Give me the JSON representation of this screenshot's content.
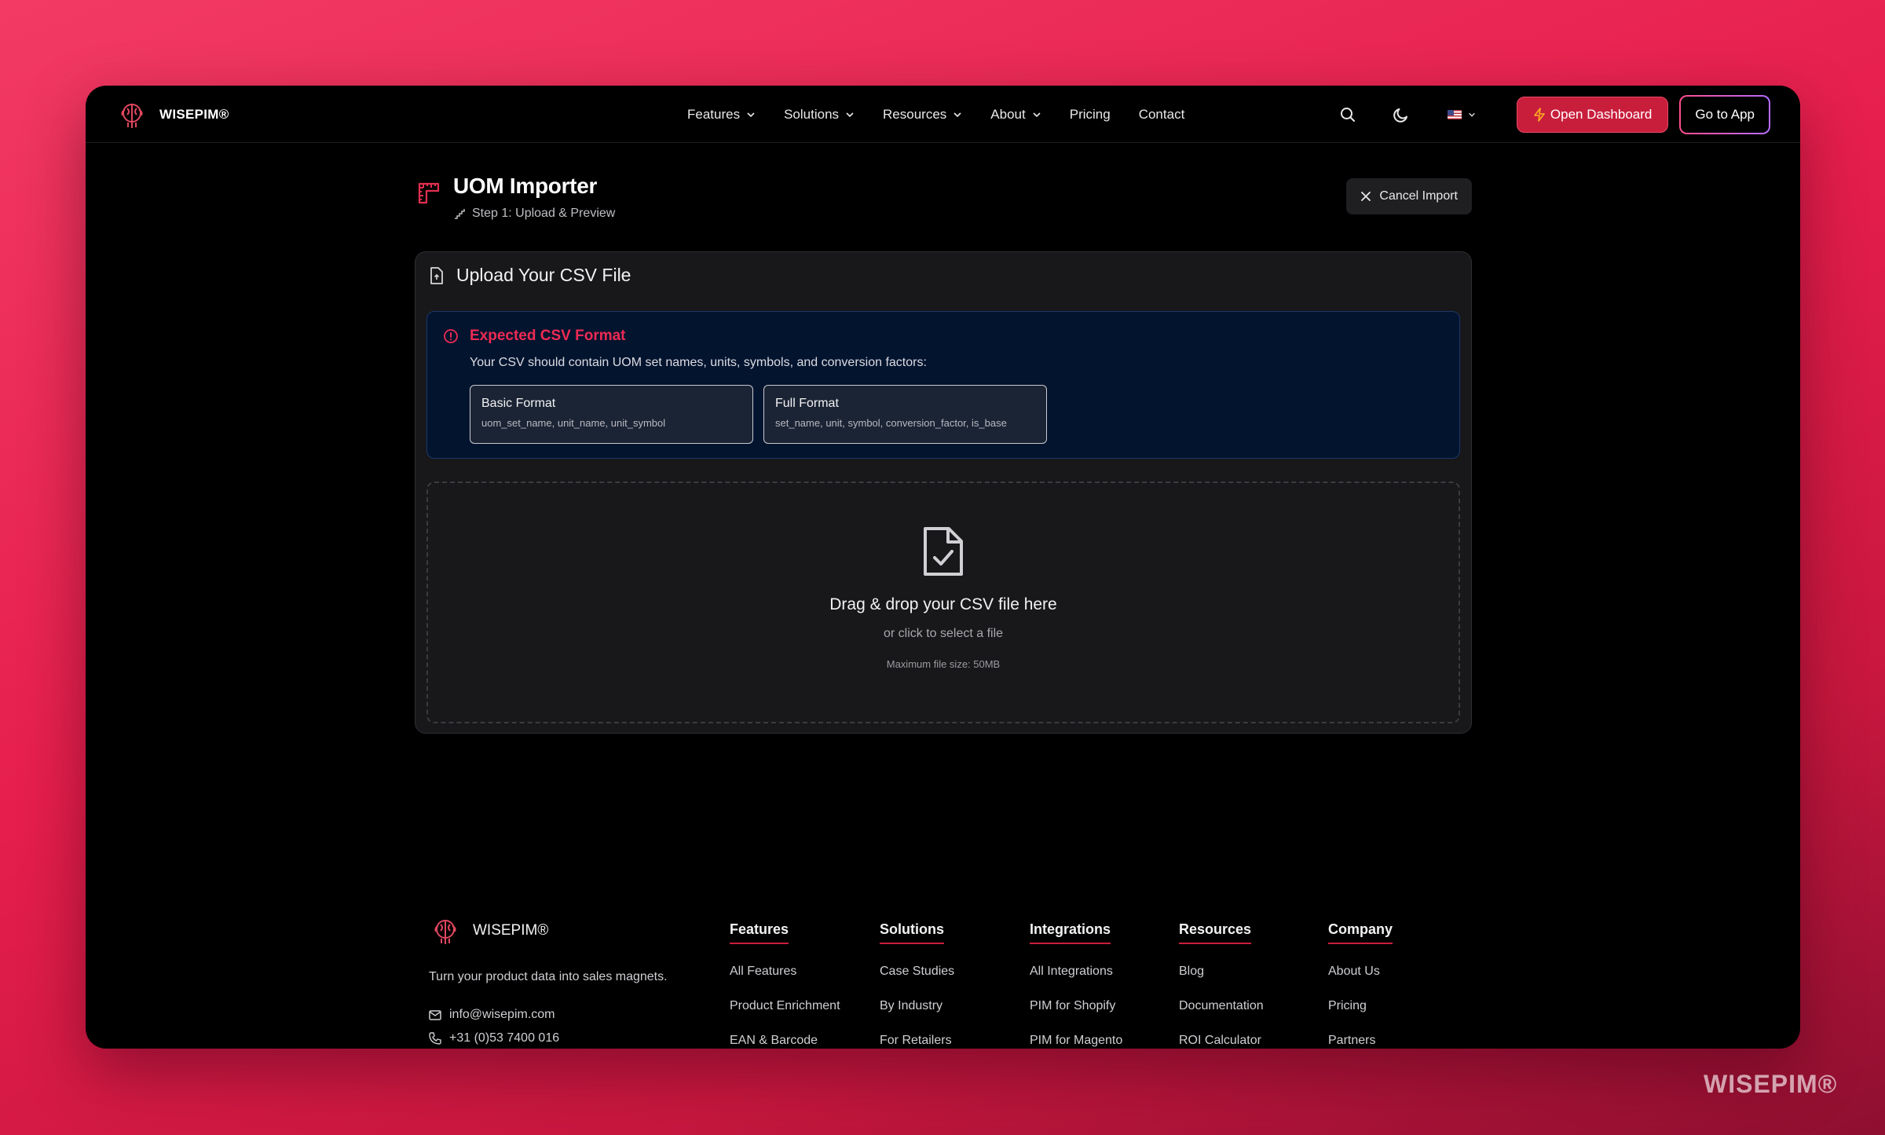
{
  "brand": {
    "name": "WISEPIM®",
    "name_short": "WISEPIM",
    "reg": "®"
  },
  "nav": {
    "items": [
      {
        "label": "Features",
        "dropdown": true
      },
      {
        "label": "Solutions",
        "dropdown": true
      },
      {
        "label": "Resources",
        "dropdown": true
      },
      {
        "label": "About",
        "dropdown": true
      },
      {
        "label": "Pricing",
        "dropdown": false
      },
      {
        "label": "Contact",
        "dropdown": false
      }
    ],
    "open_dashboard": "Open Dashboard",
    "go_to_app": "Go to App",
    "icons": [
      "search-icon",
      "moon-icon",
      "us-flag-icon",
      "chevron-down-icon"
    ]
  },
  "page": {
    "title": "UOM Importer",
    "step": "Step 1: Upload & Preview",
    "cancel": "Cancel Import"
  },
  "card": {
    "title": "Upload Your CSV File",
    "info": {
      "title": "Expected CSV Format",
      "description": "Your CSV should contain UOM set names, units, symbols, and conversion factors:",
      "formats": [
        {
          "name": "Basic Format",
          "columns": "uom_set_name, unit_name, unit_symbol"
        },
        {
          "name": "Full Format",
          "columns": "set_name, unit, symbol, conversion_factor, is_base"
        }
      ]
    },
    "dropzone": {
      "title": "Drag & drop your CSV file here",
      "subtitle": "or click to select a file",
      "max": "Maximum file size: 50MB"
    }
  },
  "footer": {
    "brand": "WISEPIM®",
    "tagline": "Turn your product data into sales magnets.",
    "email": "info@wisepim.com",
    "phone": "+31 (0)53 7400 016",
    "columns": [
      {
        "title": "Features",
        "items": [
          "All Features",
          "Product Enrichment",
          "EAN & Barcode"
        ]
      },
      {
        "title": "Solutions",
        "items": [
          "Case Studies",
          "By Industry",
          "For Retailers"
        ]
      },
      {
        "title": "Integrations",
        "items": [
          "All Integrations",
          "PIM for Shopify",
          "PIM for Magento"
        ]
      },
      {
        "title": "Resources",
        "items": [
          "Blog",
          "Documentation",
          "ROI Calculator"
        ]
      },
      {
        "title": "Company",
        "items": [
          "About Us",
          "Pricing",
          "Partners"
        ]
      }
    ]
  },
  "watermark": "WISEPIM®",
  "colors": {
    "accent": "#c81e3c",
    "info_title": "#ef2a53",
    "background": "#e61e4d"
  }
}
